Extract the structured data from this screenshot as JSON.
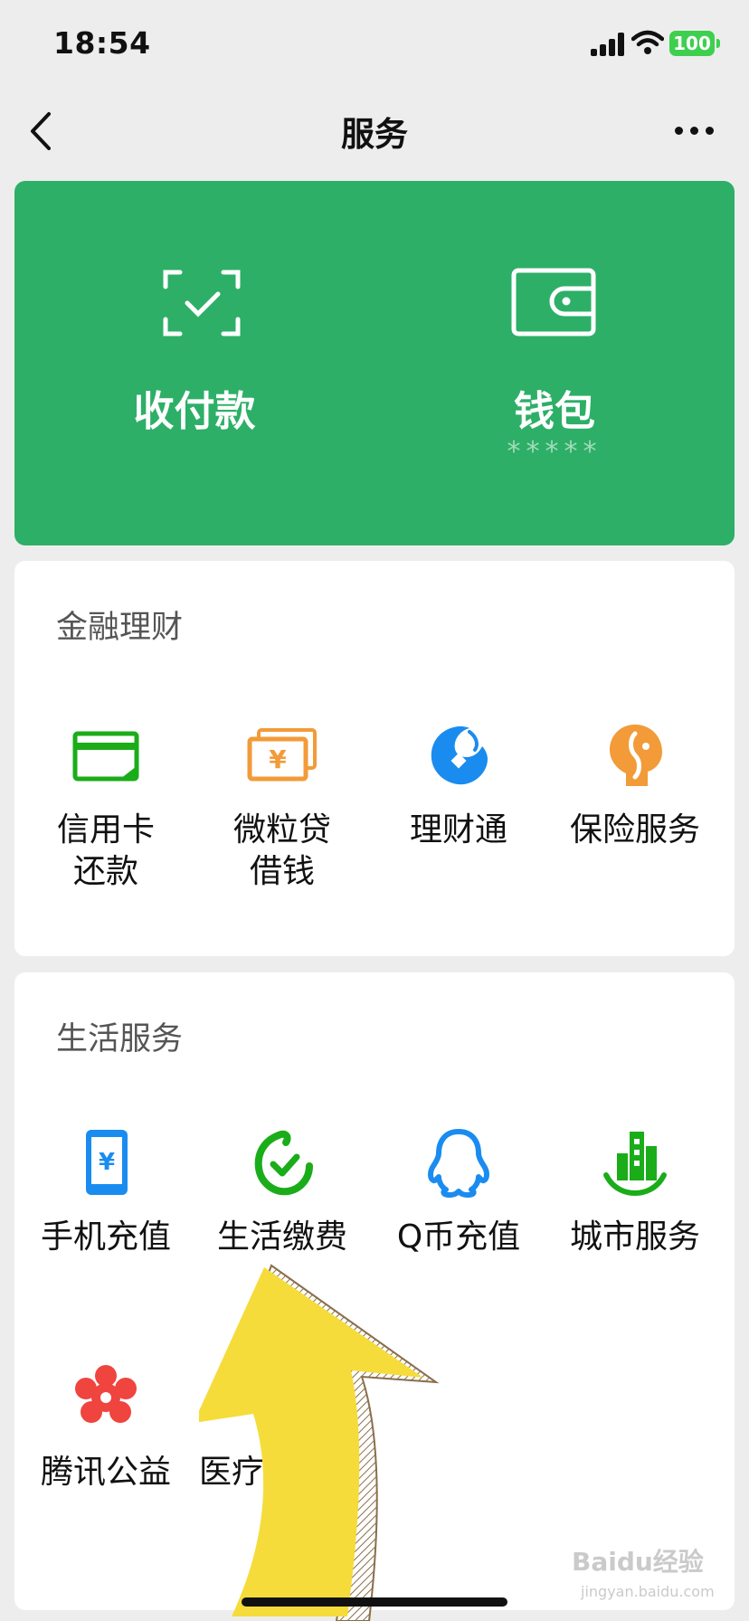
{
  "status_bar": {
    "time": "18:54",
    "battery": "100"
  },
  "nav": {
    "title": "服务"
  },
  "top_card": {
    "items": [
      {
        "label": "收付款",
        "sub": "",
        "icon": "scan-pay-icon"
      },
      {
        "label": "钱包",
        "sub": "*****",
        "icon": "wallet-icon"
      }
    ]
  },
  "finance": {
    "title": "金融理财",
    "items": [
      {
        "label": "信用卡\n还款",
        "icon": "credit-card-icon"
      },
      {
        "label": "微粒贷\n借钱",
        "icon": "loan-icon"
      },
      {
        "label": "理财通",
        "icon": "wealth-icon"
      },
      {
        "label": "保险服务",
        "icon": "insurance-icon"
      }
    ]
  },
  "life": {
    "title": "生活服务",
    "items": [
      {
        "label": "手机充值",
        "icon": "phone-topup-icon"
      },
      {
        "label": "生活缴费",
        "icon": "utility-payment-icon"
      },
      {
        "label": "Q币充值",
        "icon": "qq-coin-icon"
      },
      {
        "label": "城市服务",
        "icon": "city-service-icon"
      },
      {
        "label": "腾讯公益",
        "icon": "charity-icon"
      },
      {
        "label": "医疗",
        "icon": "medical-icon"
      }
    ]
  },
  "colors": {
    "green": "#2daf67",
    "accent_green": "#1aad19",
    "orange": "#f29b38",
    "blue": "#1a8cf0",
    "red": "#f0443f",
    "arrow_yellow": "#f5dc3a"
  },
  "watermark": {
    "text": "Baidu经验",
    "sub": "jingyan.baidu.com"
  }
}
